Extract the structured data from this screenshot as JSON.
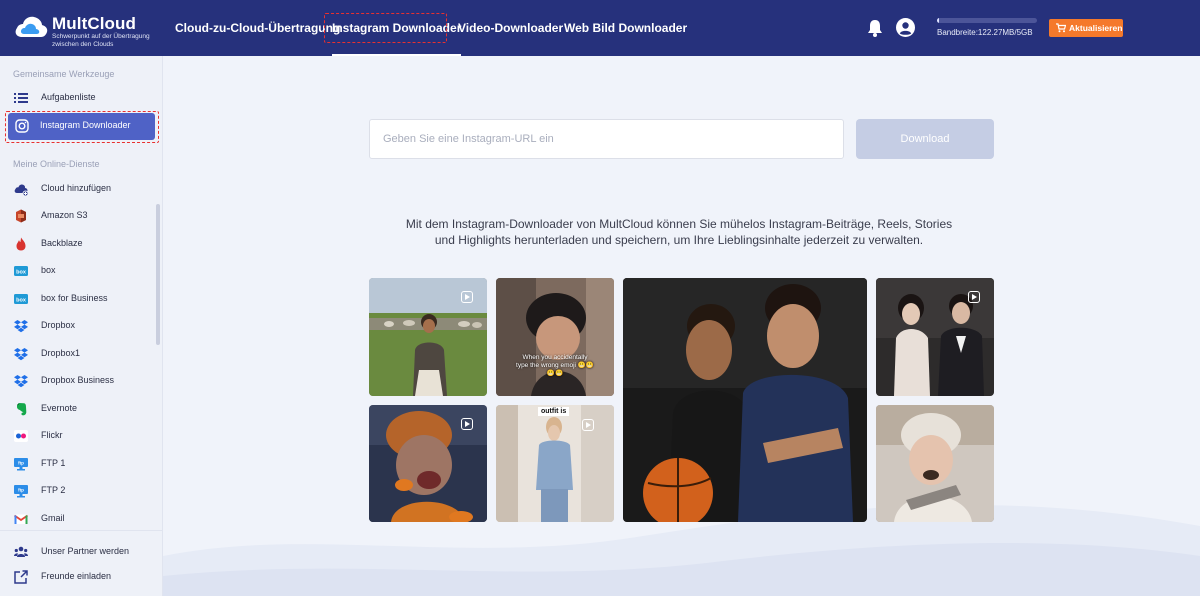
{
  "app": {
    "name": "MultCloud",
    "tagline": "Schwerpunkt auf der Übertragung zwischen den Clouds"
  },
  "nav": {
    "items": [
      {
        "label": "Cloud-zu-Cloud-Übertragung"
      },
      {
        "label": "Instagram Downloader",
        "active": true
      },
      {
        "label": "Video-Downloader"
      },
      {
        "label": "Web Bild Downloader"
      }
    ]
  },
  "header": {
    "bandwidth_label": "Bandbreite:122.27MB/5GB",
    "bandwidth_fraction": 0.024,
    "upgrade_label": "Aktualisieren",
    "icons": [
      "bell-icon",
      "user-icon",
      "cart-icon"
    ]
  },
  "sidebar": {
    "section_tools": "Gemeinsame Werkzeuge",
    "tools": [
      {
        "label": "Aufgabenliste",
        "icon": "list-icon"
      },
      {
        "label": "Instagram Downloader",
        "icon": "instagram-icon",
        "active": true
      }
    ],
    "section_services": "Meine Online-Dienste",
    "services": [
      {
        "label": "Cloud hinzufügen",
        "icon": "cloud-add-icon"
      },
      {
        "label": "Amazon S3",
        "icon": "amazon-s3-icon"
      },
      {
        "label": "Backblaze",
        "icon": "backblaze-icon"
      },
      {
        "label": "box",
        "icon": "box-icon"
      },
      {
        "label": "box for Business",
        "icon": "box-business-icon"
      },
      {
        "label": "Dropbox",
        "icon": "dropbox-icon"
      },
      {
        "label": "Dropbox1",
        "icon": "dropbox-icon"
      },
      {
        "label": "Dropbox Business",
        "icon": "dropbox-business-icon"
      },
      {
        "label": "Evernote",
        "icon": "evernote-icon"
      },
      {
        "label": "Flickr",
        "icon": "flickr-icon"
      },
      {
        "label": "FTP 1",
        "icon": "ftp-icon"
      },
      {
        "label": "FTP 2",
        "icon": "ftp-icon"
      },
      {
        "label": "Gmail",
        "icon": "gmail-icon"
      }
    ],
    "footer": [
      {
        "label": "Unser Partner werden",
        "icon": "partner-icon"
      },
      {
        "label": "Freunde einladen",
        "icon": "invite-icon"
      }
    ]
  },
  "main": {
    "url_placeholder": "Geben Sie eine Instagram-URL ein",
    "url_value": "",
    "download_label": "Download",
    "description": "Mit dem Instagram-Downloader von MultCloud können Sie mühelos Instagram-Beiträge, Reels, Stories und Highlights herunterladen und speichern, um Ihre Lieblingsinhalte jederzeit zu verwalten.",
    "tiles": [
      {
        "name": "woman-field-photo"
      },
      {
        "name": "man-meme-photo",
        "caption": "When you accidentally type the wrong emoji 😬😬 😬😬"
      },
      {
        "name": "two-men-basketball-photo"
      },
      {
        "name": "couple-seated-photo"
      },
      {
        "name": "dog-costume-photo"
      },
      {
        "name": "outfit-photo",
        "caption": "outfit is"
      },
      {
        "name": "woman-beanie-photo"
      }
    ]
  },
  "colors": {
    "topbar": "#26317c",
    "accent": "#4f62c6",
    "upgrade": "#f5792b",
    "highlight": "#e8302f",
    "download_disabled": "#c5cde4"
  }
}
